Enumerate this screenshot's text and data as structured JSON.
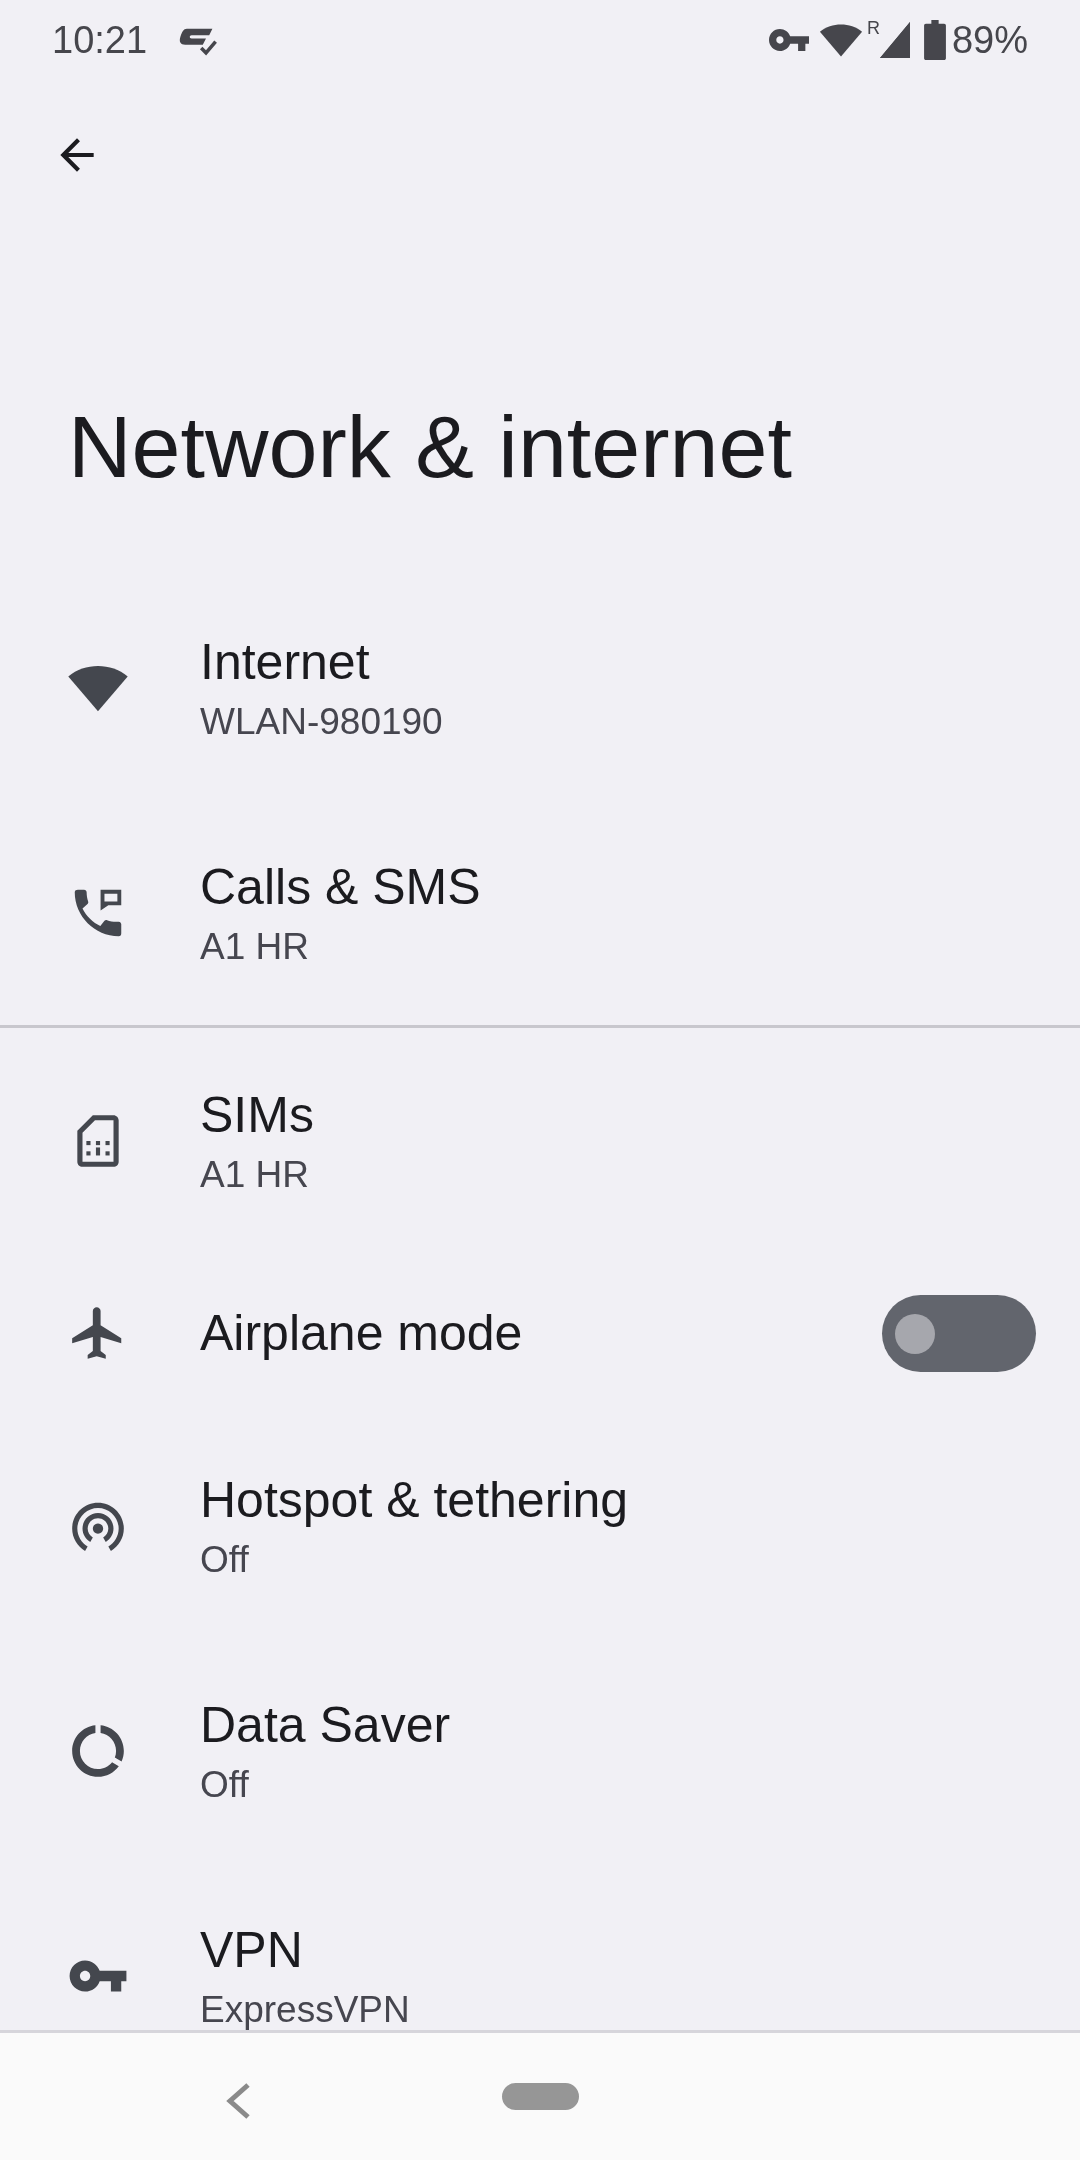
{
  "status_bar": {
    "time": "10:21",
    "roaming": "R",
    "battery": "89%"
  },
  "title": "Network & internet",
  "sections": [
    {
      "items": [
        {
          "kind": "link",
          "title": "Internet",
          "subtitle": "WLAN-980190"
        },
        {
          "kind": "link",
          "title": "Calls & SMS",
          "subtitle": "A1 HR"
        }
      ]
    },
    {
      "items": [
        {
          "kind": "link",
          "title": "SIMs",
          "subtitle": "A1 HR"
        },
        {
          "kind": "toggle",
          "title": "Airplane mode",
          "on": false
        },
        {
          "kind": "link",
          "title": "Hotspot & tethering",
          "subtitle": "Off"
        },
        {
          "kind": "link",
          "title": "Data Saver",
          "subtitle": "Off"
        },
        {
          "kind": "link",
          "title": "VPN",
          "subtitle": "ExpressVPN"
        }
      ]
    }
  ]
}
